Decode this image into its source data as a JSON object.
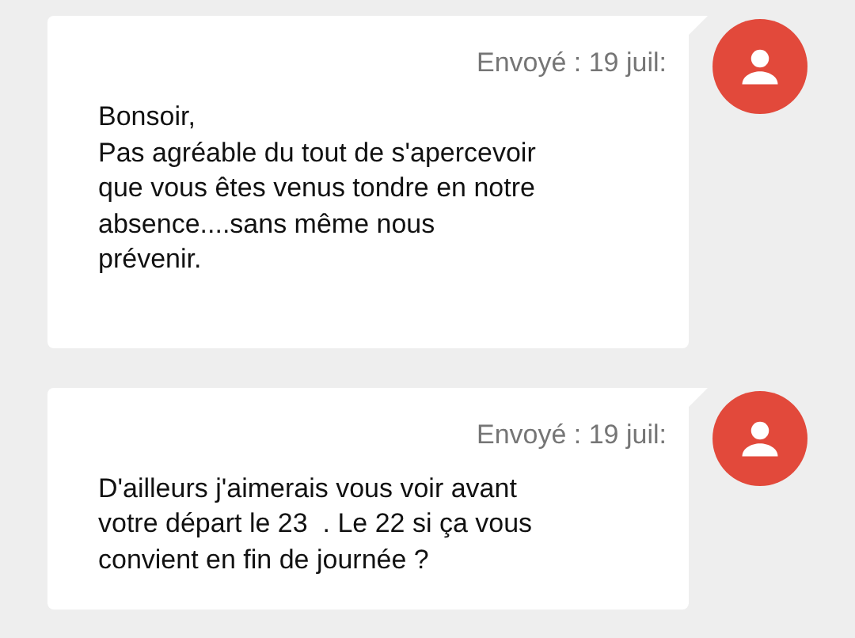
{
  "messages": [
    {
      "meta": "Envoyé : 19 juil:",
      "text": "Bonsoir,\nPas agréable du tout de s'apercevoir\nque vous êtes venus tondre en notre\nabsence....sans même nous\nprévenir."
    },
    {
      "meta": "Envoyé : 19 juil:",
      "text": "D'ailleurs j'aimerais vous voir avant\nvotre départ le 23  . Le 22 si ça vous\nconvient en fin de journée ?"
    }
  ]
}
